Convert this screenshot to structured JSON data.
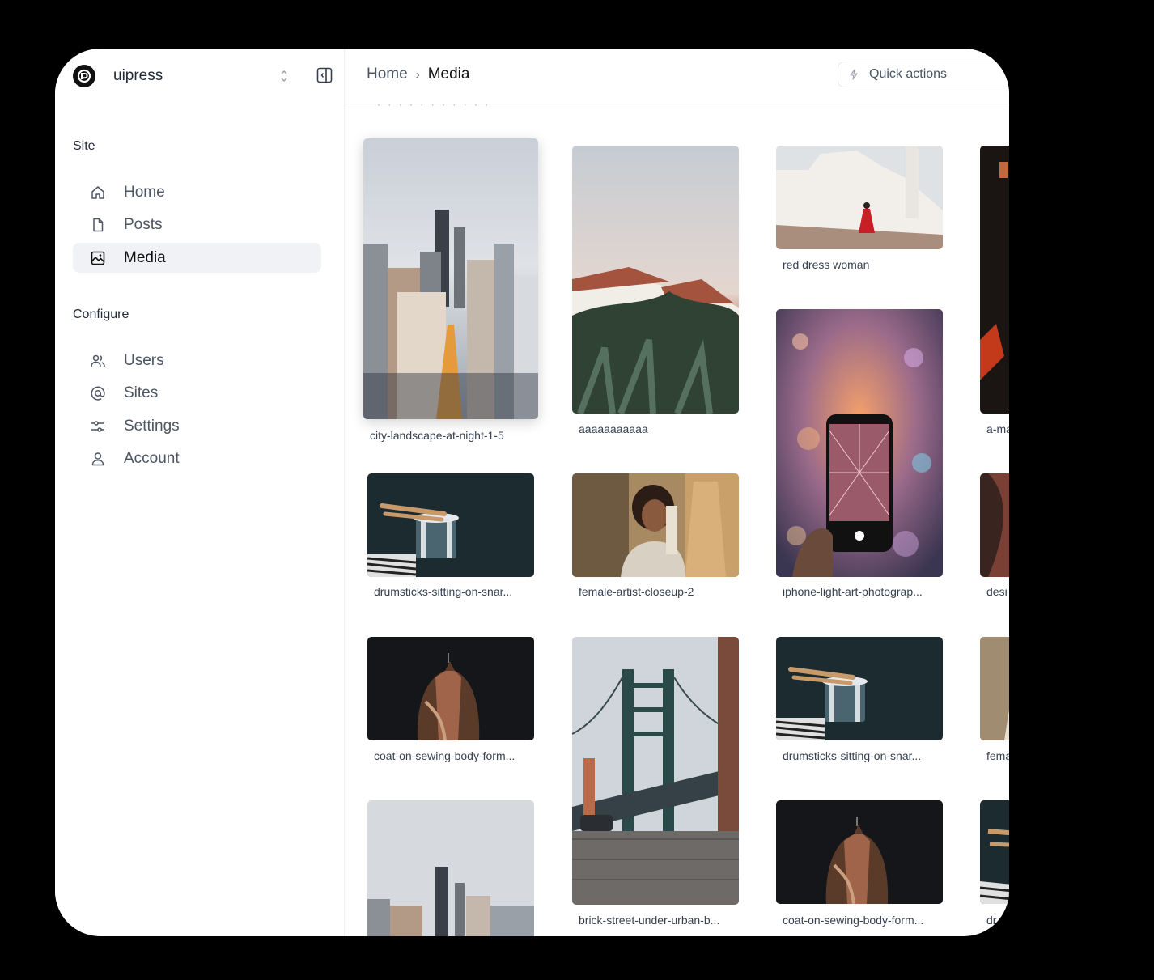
{
  "brand": {
    "name": "uipress"
  },
  "sidebar": {
    "site_title": "Site",
    "site_items": [
      {
        "label": "Home",
        "icon": "home-icon"
      },
      {
        "label": "Posts",
        "icon": "file-icon"
      },
      {
        "label": "Media",
        "icon": "image-icon",
        "active": true
      }
    ],
    "configure_title": "Configure",
    "configure_items": [
      {
        "label": "Users",
        "icon": "users-icon"
      },
      {
        "label": "Sites",
        "icon": "at-icon"
      },
      {
        "label": "Settings",
        "icon": "sliders-icon"
      },
      {
        "label": "Account",
        "icon": "user-icon"
      }
    ]
  },
  "breadcrumb": {
    "home": "Home",
    "separator": "›",
    "current": "Media"
  },
  "quick_actions": {
    "label": "Quick actions"
  },
  "media": {
    "items": [
      {
        "caption": "city-landscape-at-night-1-5"
      },
      {
        "caption": "aaaaaaaaaaa"
      },
      {
        "caption": "red dress woman"
      },
      {
        "caption": "a-ma"
      },
      {
        "caption": "drumsticks-sitting-on-snar..."
      },
      {
        "caption": "female-artist-closeup-2"
      },
      {
        "caption": "iphone-light-art-photograp..."
      },
      {
        "caption": "desi"
      },
      {
        "caption": "coat-on-sewing-body-form..."
      },
      {
        "caption": "brick-street-under-urban-b..."
      },
      {
        "caption": "drumsticks-sitting-on-snar..."
      },
      {
        "caption": "fema"
      },
      {
        "caption": ""
      },
      {
        "caption": "coat-on-sewing-body-form..."
      },
      {
        "caption": "dr"
      }
    ]
  },
  "colors": {
    "active_bg": "#f1f2f5",
    "text": "#111827",
    "muted": "#4b5563"
  }
}
